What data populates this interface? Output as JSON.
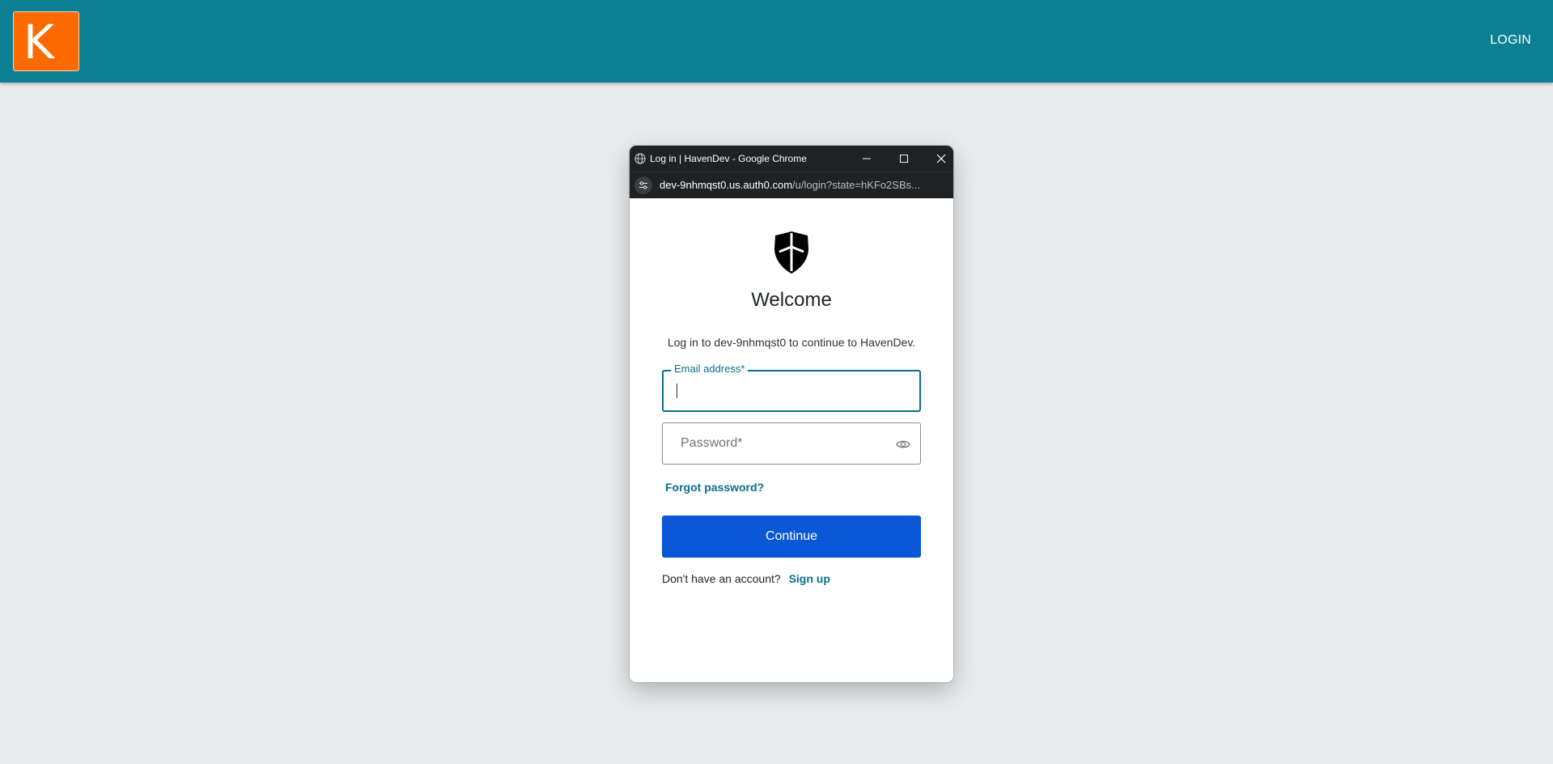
{
  "app": {
    "logo_letter": "K",
    "login_label": "LOGIN",
    "colors": {
      "topbar": "#0d7f92",
      "logo": "#ff6a00",
      "background": "#e8ecef"
    }
  },
  "popup": {
    "window_title": "Log in | HavenDev - Google Chrome",
    "url_host": "dev-9nhmqst0.us.auth0.com",
    "url_path": "/u/login?state=hKFo2SBs...",
    "icons": {
      "site": "globe-icon",
      "site_settings": "tune-icon",
      "minimize": "minimize-icon",
      "maximize": "maximize-icon",
      "close": "close-icon"
    }
  },
  "login_form": {
    "brand_icon": "shield-icon",
    "heading": "Welcome",
    "subtitle": "Log in to dev-9nhmqst0 to continue to HavenDev.",
    "email_label": "Email address*",
    "email_value": "",
    "password_placeholder": "Password*",
    "password_icon": "eye-icon",
    "forgot_password": "Forgot password?",
    "continue_label": "Continue",
    "no_account_text": "Don't have an account?",
    "signup_label": "Sign up",
    "colors": {
      "primary_button": "#0a57d8",
      "link": "#0b6f8a"
    }
  }
}
